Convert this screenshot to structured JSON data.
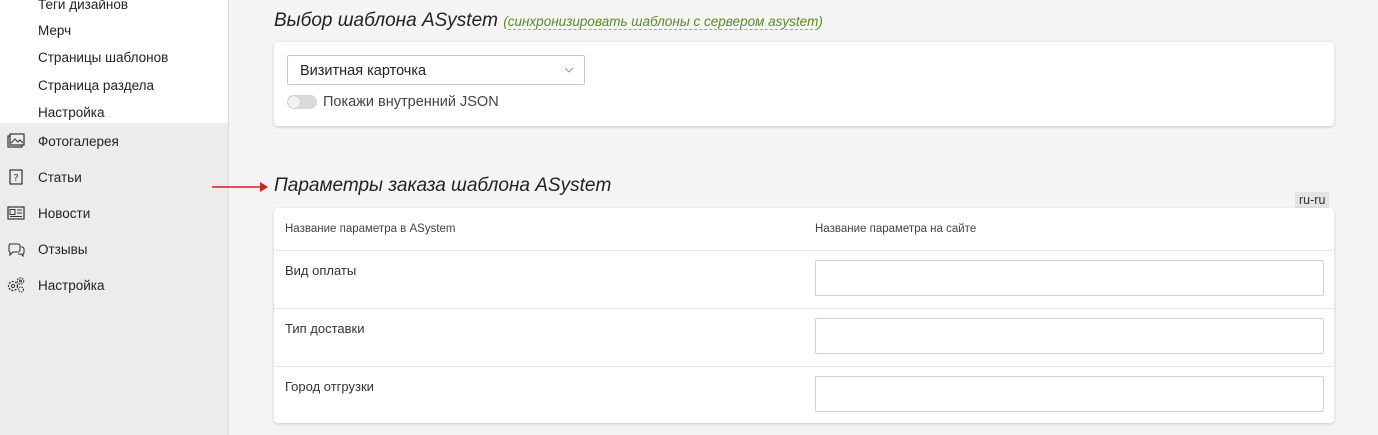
{
  "sidebar": {
    "sub_items": [
      {
        "label": "Теги дизайнов"
      },
      {
        "label": "Мерч"
      },
      {
        "label": "Страницы шаблонов"
      },
      {
        "label": "Страница раздела"
      },
      {
        "label": "Настройка"
      }
    ],
    "main_items": [
      {
        "label": "Фотогалерея",
        "icon": "photo-gallery-icon"
      },
      {
        "label": "Статьи",
        "icon": "question-icon"
      },
      {
        "label": "Новости",
        "icon": "newspaper-icon"
      },
      {
        "label": "Отзывы",
        "icon": "chat-bubbles-icon"
      },
      {
        "label": "Настройка",
        "icon": "gears-icon"
      }
    ]
  },
  "template_section": {
    "title": "Выбор шаблона ASystem",
    "sync_open": "(",
    "sync_link": "синхронизировать шаблоны с сервером asystem",
    "sync_close": ")",
    "select_value": "Визитная карточка",
    "toggle_label": "Покажи внутренний JSON",
    "toggle_on": false
  },
  "params_section": {
    "title": "Параметры заказа шаблона ASystem",
    "lang_badge": "ru-ru",
    "col_asystem": "Название параметра в ASystem",
    "col_site": "Название параметра на сайте",
    "rows": [
      {
        "name": "Вид оплаты",
        "value": ""
      },
      {
        "name": "Тип доставки",
        "value": ""
      },
      {
        "name": "Город отгрузки",
        "value": ""
      }
    ]
  },
  "colors": {
    "accent_link": "#5a8a2a",
    "arrow": "#d21f1f"
  }
}
